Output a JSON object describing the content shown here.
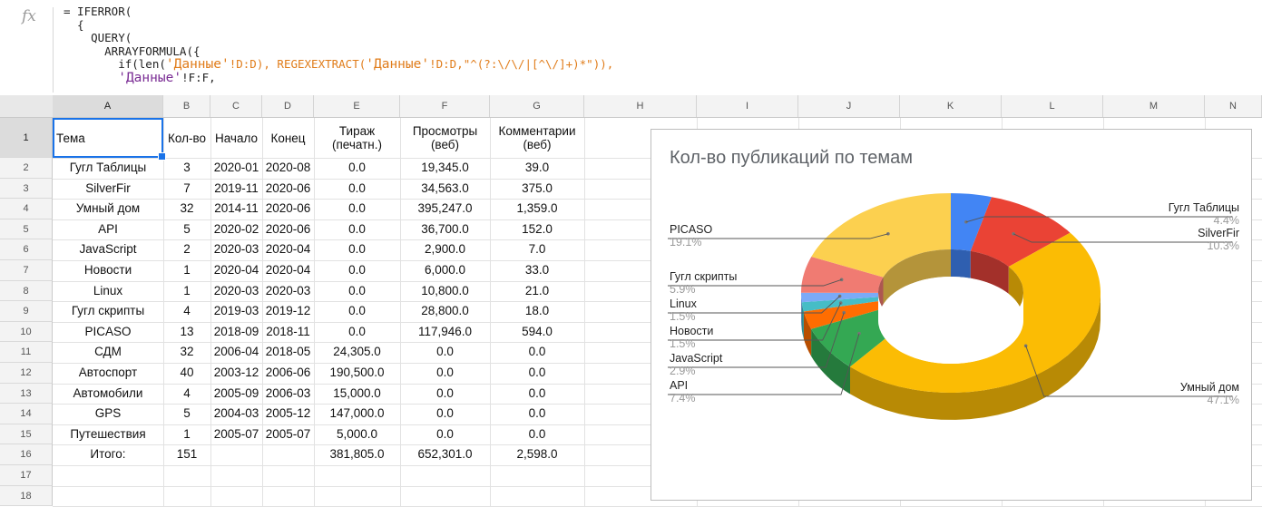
{
  "formula_bar": {
    "fx_label": "fx",
    "lines": [
      "= IFERROR(",
      "  {",
      "    QUERY(",
      "      ARRAYFORMULA({",
      "        if(len(",
      "        'Данные'!F:F,"
    ],
    "line5_parts": [
      "        if(len(",
      "'Данные'",
      "!D:D), REGEXEXTRACT(",
      "'Данные'",
      "!D:D,\"^(?:\\/\\/|[^\\/]+)*\")),"
    ],
    "line6_parts": [
      "        ",
      "'Данные'",
      "!F:F,"
    ]
  },
  "columns": [
    "A",
    "B",
    "C",
    "D",
    "E",
    "F",
    "G",
    "H",
    "I",
    "J",
    "K",
    "L",
    "M",
    "N"
  ],
  "rows": [
    "1",
    "2",
    "3",
    "4",
    "5",
    "6",
    "7",
    "8",
    "9",
    "10",
    "11",
    "12",
    "13",
    "14",
    "15",
    "16",
    "17",
    "18"
  ],
  "table": {
    "headers": [
      "Тема",
      "Кол-во",
      "Начало",
      "Конец",
      "Тираж (печатн.)",
      "Просмотры (веб)",
      "Комментарии (веб)"
    ],
    "header_lines": [
      [
        "Тема"
      ],
      [
        "Кол-во"
      ],
      [
        "Начало"
      ],
      [
        "Конец"
      ],
      [
        "Тираж",
        "(печатн.)"
      ],
      [
        "Просмотры",
        "(веб)"
      ],
      [
        "Комментарии",
        "(веб)"
      ]
    ],
    "rows": [
      [
        "Гугл Таблицы",
        "3",
        "2020-01",
        "2020-08",
        "0.0",
        "19,345.0",
        "39.0"
      ],
      [
        "SilverFir",
        "7",
        "2019-11",
        "2020-06",
        "0.0",
        "34,563.0",
        "375.0"
      ],
      [
        "Умный дом",
        "32",
        "2014-11",
        "2020-06",
        "0.0",
        "395,247.0",
        "1,359.0"
      ],
      [
        "API",
        "5",
        "2020-02",
        "2020-06",
        "0.0",
        "36,700.0",
        "152.0"
      ],
      [
        "JavaScript",
        "2",
        "2020-03",
        "2020-04",
        "0.0",
        "2,900.0",
        "7.0"
      ],
      [
        "Новости",
        "1",
        "2020-04",
        "2020-04",
        "0.0",
        "6,000.0",
        "33.0"
      ],
      [
        "Linux",
        "1",
        "2020-03",
        "2020-03",
        "0.0",
        "10,800.0",
        "21.0"
      ],
      [
        "Гугл скрипты",
        "4",
        "2019-03",
        "2019-12",
        "0.0",
        "28,800.0",
        "18.0"
      ],
      [
        "PICASO",
        "13",
        "2018-09",
        "2018-11",
        "0.0",
        "117,946.0",
        "594.0"
      ],
      [
        "СДМ",
        "32",
        "2006-04",
        "2018-05",
        "24,305.0",
        "0.0",
        "0.0"
      ],
      [
        "Автоспорт",
        "40",
        "2003-12",
        "2006-06",
        "190,500.0",
        "0.0",
        "0.0"
      ],
      [
        "Автомобили",
        "4",
        "2005-09",
        "2006-03",
        "15,000.0",
        "0.0",
        "0.0"
      ],
      [
        "GPS",
        "5",
        "2004-03",
        "2005-12",
        "147,000.0",
        "0.0",
        "0.0"
      ],
      [
        "Путешествия",
        "1",
        "2005-07",
        "2005-07",
        "5,000.0",
        "0.0",
        "0.0"
      ],
      [
        "Итого:",
        "151",
        "",
        "",
        "381,805.0",
        "652,301.0",
        "2,598.0"
      ]
    ]
  },
  "chart_data": {
    "type": "pie",
    "title": "Кол-во публикаций по темам",
    "donut": true,
    "three_d": true,
    "categories": [
      "Гугл Таблицы",
      "SilverFir",
      "Умный дом",
      "API",
      "JavaScript",
      "Новости",
      "Linux",
      "Гугл скрипты",
      "PICASO"
    ],
    "values": [
      4.4,
      10.3,
      47.1,
      7.4,
      2.9,
      1.5,
      1.5,
      5.9,
      19.1
    ],
    "labels": [
      "4.4%",
      "10.3%",
      "47.1%",
      "7.4%",
      "2.9%",
      "1.5%",
      "1.5%",
      "5.9%",
      "19.1%"
    ],
    "colors": [
      "#4285f4",
      "#ea4335",
      "#fbbc04",
      "#34a853",
      "#ff6d01",
      "#46bdc6",
      "#7baaf7",
      "#f07b72",
      "#fcd04f"
    ],
    "dark_colors": [
      "#2f5fb0",
      "#a3302a",
      "#b88a05",
      "#257a3c",
      "#b84e00",
      "#2f8a90",
      "#5477b3",
      "#ad5751",
      "#b4943a"
    ],
    "legend": "callouts"
  }
}
